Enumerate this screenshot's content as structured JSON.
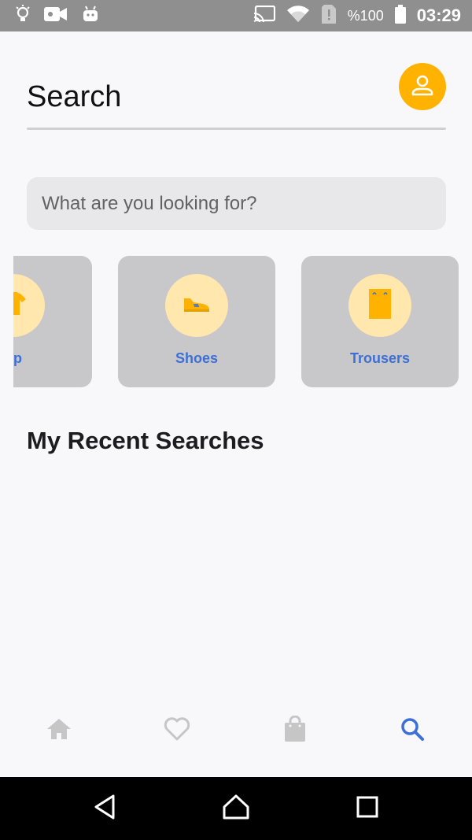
{
  "status_bar": {
    "battery_text": "%100",
    "time": "03:29",
    "icons": [
      "lightbulb-icon",
      "video-camera-icon",
      "android-icon",
      "cast-icon",
      "wifi-icon",
      "sim-alert-icon",
      "battery-icon"
    ]
  },
  "header": {
    "title": "Search",
    "profile_icon": "person-icon"
  },
  "search": {
    "placeholder": "What are you looking for?",
    "value": ""
  },
  "categories": [
    {
      "label": "op",
      "icon": "shirt-icon"
    },
    {
      "label": "Shoes",
      "icon": "shoe-icon"
    },
    {
      "label": "Trousers",
      "icon": "trousers-icon"
    }
  ],
  "recent": {
    "title": "My Recent Searches"
  },
  "bottom_nav": [
    {
      "icon": "home-icon",
      "active": false
    },
    {
      "icon": "heart-icon",
      "active": false
    },
    {
      "icon": "shopping-bag-icon",
      "active": false
    },
    {
      "icon": "search-icon",
      "active": true
    }
  ],
  "colors": {
    "accent": "#ffb300",
    "label": "#3d6fd6",
    "card": "#c8c7ca",
    "icon_circle": "#ffe7ad",
    "inactive_nav": "#c6c6c6",
    "active_nav": "#3d6fd6"
  }
}
